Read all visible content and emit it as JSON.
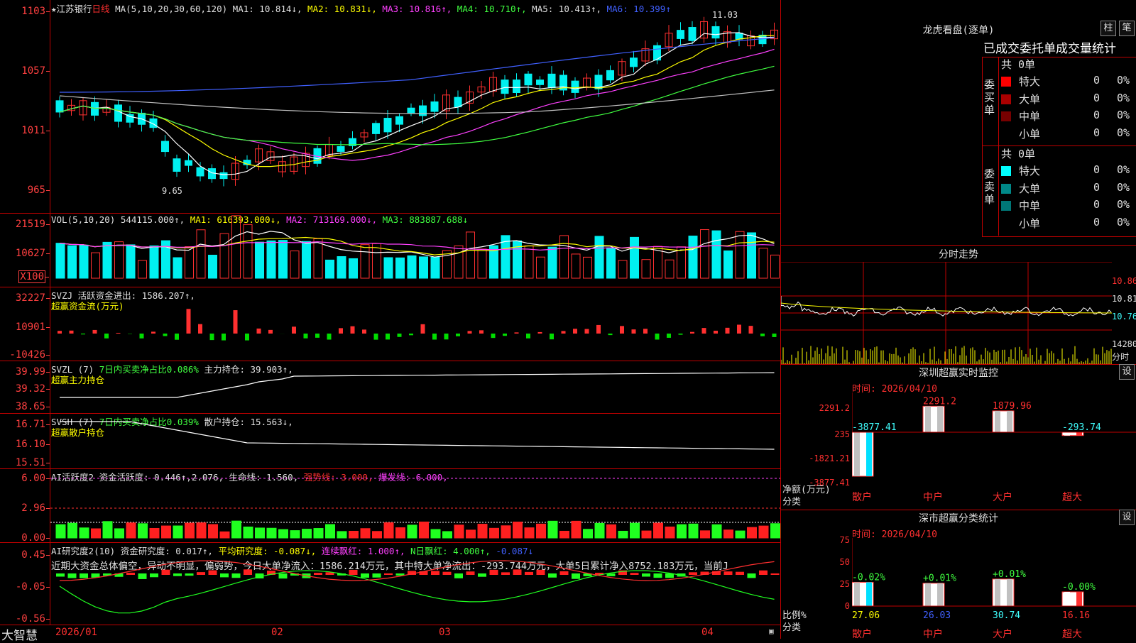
{
  "stock": {
    "name": "江苏银行",
    "period": "日线",
    "star": "★"
  },
  "ma_line": {
    "title": "MA(5,10,20,30,60,120)",
    "ma1": "MA1: 10.814↓,",
    "ma2": "MA2: 10.831↓,",
    "ma3": "MA3: 10.816↑,",
    "ma4": "MA4: 10.710↑,",
    "ma5": "MA5: 10.413↑,",
    "ma6": "MA6: 10.399↑"
  },
  "colors": {
    "up": "#ff3030",
    "down": "#00f0f0",
    "grid": "#c00000"
  },
  "price_axis": [
    "1103",
    "1057",
    "1011",
    "965"
  ],
  "price_marks": {
    "high": "11.03",
    "low": "9.65"
  },
  "vol": {
    "title": "VOL(5,10,20)",
    "value": "544115.000↑,",
    "ma1": "MA1: 616393.000↓,",
    "ma2": "MA2: 713169.000↓,",
    "ma3": "MA3: 883887.688↓",
    "axis": [
      "21519",
      "10627",
      "X100"
    ]
  },
  "svzj": {
    "title": "SVZJ",
    "label": "活跃资金进出: 1586.207↑,",
    "sub": "超赢资金流(万元)",
    "axis": [
      "32227",
      "10901",
      "-10426"
    ]
  },
  "svzl": {
    "title": "SVZL (7)",
    "pct": "7日内买卖净占比0.086%",
    "hold": "主力持仓: 39.903↑,",
    "sub": "超赢主力持仓",
    "axis": [
      "39.99",
      "39.32",
      "38.65"
    ]
  },
  "svsh": {
    "title": "SVSH (7)",
    "pct": "7日内买卖净占比0.039%",
    "hold": "散户持仓: 15.563↓,",
    "sub": "超赢散户持仓",
    "axis": [
      "16.71",
      "16.10",
      "15.51"
    ]
  },
  "ai1": {
    "title": "AI活跃度2",
    "l1": "资金活跃度: 0.446↑,",
    "l2": "2.076,",
    "l3": "生命线: 1.560,",
    "l4": "强势线: 3.000,",
    "l5": "爆发线: 6.000,",
    "axis": [
      "6.00",
      "2.96",
      "0.00"
    ]
  },
  "ai2": {
    "title": "AI研究度2(10)",
    "l1": "资金研究度: 0.017↑,",
    "l2": "平均研究度: -0.087↓,",
    "l3": "连续飘红: 1.000↑,",
    "l4": "N日飘红: 4.000↑,",
    "l5": "-0.087↓",
    "text": "近期大资金总体偏空，异动不明显，偏弱势，今日大单净流入：1586.214万元，其中特大单净流出：-293.744万元，大单5日累计净入8752.183万元，当前J",
    "axis": [
      "0.45",
      "-0.05",
      "-0.56"
    ]
  },
  "bottom": {
    "brand": "大智慧",
    "dates": [
      "2026/01",
      "02",
      "03",
      "04"
    ]
  },
  "lhb": {
    "title": "龙虎看盘(逐单)",
    "btn1": "柱",
    "btn2": "笔",
    "sub": "已成交委托单成交量统计",
    "buy": {
      "label": "委买单",
      "total": "共 0单",
      "rows": [
        {
          "name": "特大",
          "v": "0",
          "p": "0%",
          "c": "#ff0000"
        },
        {
          "name": "大单",
          "v": "0",
          "p": "0%",
          "c": "#aa0000"
        },
        {
          "name": "中单",
          "v": "0",
          "p": "0%",
          "c": "#770000"
        },
        {
          "name": "小单",
          "v": "0",
          "p": "0%",
          "c": "#000000"
        }
      ]
    },
    "sell": {
      "label": "委卖单",
      "total": "共 0单",
      "rows": [
        {
          "name": "特大",
          "v": "0",
          "p": "0%",
          "c": "#00ffff"
        },
        {
          "name": "大单",
          "v": "0",
          "p": "0%",
          "c": "#008888"
        },
        {
          "name": "中单",
          "v": "0",
          "p": "0%",
          "c": "#007777"
        },
        {
          "name": "小单",
          "v": "0",
          "p": "0%",
          "c": "#000000"
        }
      ]
    }
  },
  "intraday": {
    "title": "分时走势",
    "axis": [
      "10.86",
      "10.81",
      "10.76",
      "14280"
    ],
    "unit": "分时"
  },
  "sz_rt": {
    "title": "深圳超赢实时监控",
    "btn": "设",
    "time": "时间: 2026/04/10",
    "axis": [
      "2291.2",
      "235",
      "-1821.21",
      "-3877.41"
    ],
    "ylabel": "净额(万元)",
    "xlabel": "分类",
    "cats": [
      "散户",
      "中户",
      "大户",
      "超大"
    ],
    "vals": [
      "-3877.41",
      "2291.2",
      "1879.96",
      "-293.74"
    ]
  },
  "sz_cls": {
    "title": "深市超赢分类统计",
    "btn": "设",
    "time": "时间: 2026/04/10",
    "axis": [
      "75",
      "50",
      "25",
      "0"
    ],
    "ylabel": "比例%",
    "xlabel": "分类",
    "cats": [
      "散户",
      "中户",
      "大户",
      "超大"
    ],
    "vals": [
      "27.06",
      "26.03",
      "30.74",
      "16.16"
    ],
    "chg": [
      "-0.02%",
      "+0.01%",
      "+0.01%",
      "-0.00%"
    ]
  }
}
